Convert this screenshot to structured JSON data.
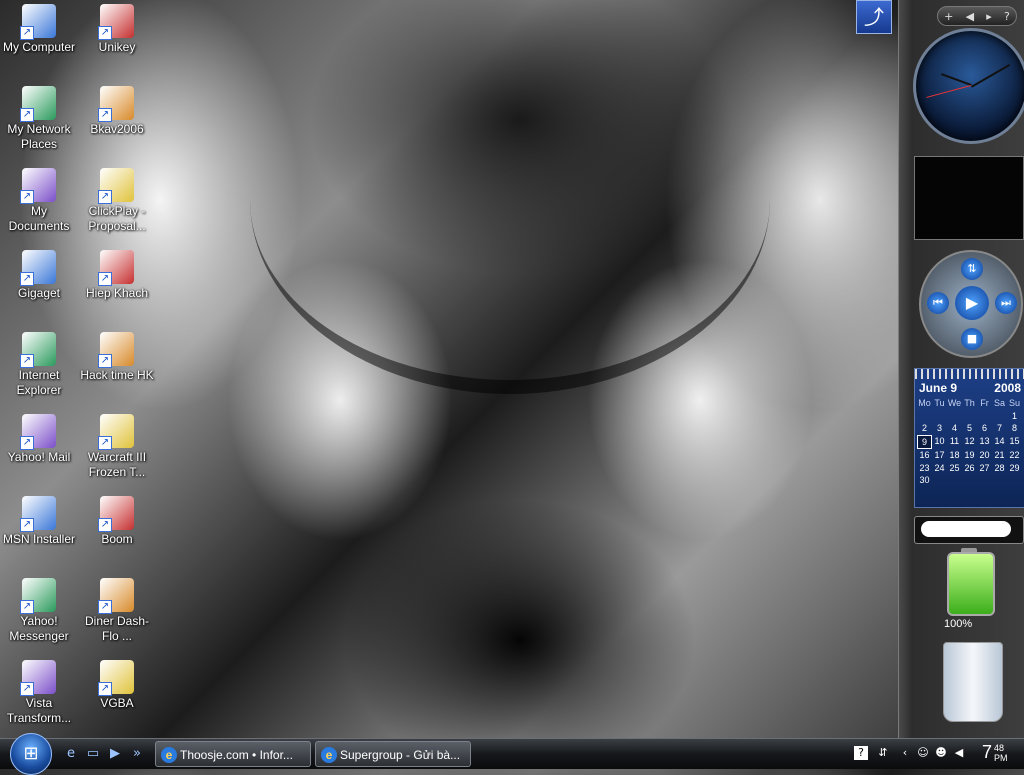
{
  "desktop": {
    "icons": [
      {
        "label": "My Computer",
        "icon": "computer-icon"
      },
      {
        "label": "Unikey",
        "icon": "unikey-icon"
      },
      {
        "label": "My Network Places",
        "icon": "network-icon"
      },
      {
        "label": "Bkav2006",
        "icon": "bkav-icon"
      },
      {
        "label": "My Documents",
        "icon": "documents-icon"
      },
      {
        "label": "ClickPlay - Proposal...",
        "icon": "document-icon"
      },
      {
        "label": "Gigaget",
        "icon": "gigaget-icon"
      },
      {
        "label": "Hiep Khach",
        "icon": "game-icon"
      },
      {
        "label": "Internet Explorer",
        "icon": "internet-explorer-icon"
      },
      {
        "label": "Hack time HK",
        "icon": "app-icon"
      },
      {
        "label": "Yahoo! Mail",
        "icon": "yahoo-mail-icon"
      },
      {
        "label": "Warcraft III Frozen T...",
        "icon": "warcraft-icon"
      },
      {
        "label": "MSN Installer",
        "icon": "msn-icon"
      },
      {
        "label": "Boom",
        "icon": "boom-icon"
      },
      {
        "label": "Yahoo! Messenger",
        "icon": "yahoo-messenger-icon"
      },
      {
        "label": "Diner Dash-Flo ...",
        "icon": "diner-dash-icon"
      },
      {
        "label": "Vista Transform...",
        "icon": "vista-transform-icon"
      },
      {
        "label": "VGBA",
        "icon": "vgba-icon"
      }
    ]
  },
  "sidebar": {
    "calendar": {
      "month": "June 9",
      "year": "2008",
      "weekdays": [
        "Mo",
        "Tu",
        "We",
        "Th",
        "Fr",
        "Sa",
        "Su"
      ],
      "days": [
        "",
        "",
        "",
        "",
        "",
        "",
        "1",
        "2",
        "3",
        "4",
        "5",
        "6",
        "7",
        "8",
        "9",
        "10",
        "11",
        "12",
        "13",
        "14",
        "15",
        "16",
        "17",
        "18",
        "19",
        "20",
        "21",
        "22",
        "23",
        "24",
        "25",
        "26",
        "27",
        "28",
        "29",
        "30"
      ],
      "today": "9"
    },
    "battery": {
      "label": "100%",
      "level": 1.0
    },
    "recycle_bin": {
      "label": "Recycle Bin"
    }
  },
  "taskbar": {
    "tasks": [
      {
        "label": "Thoosje.com • Infor..."
      },
      {
        "label": "Supergroup - Gửi bà..."
      }
    ],
    "clock": {
      "time": "7",
      "minutes": "48",
      "ampm": "PM"
    }
  },
  "colors": {
    "taskbar": "#16181b",
    "calendar": "#1d3f86",
    "accent": "#2a7be0"
  }
}
